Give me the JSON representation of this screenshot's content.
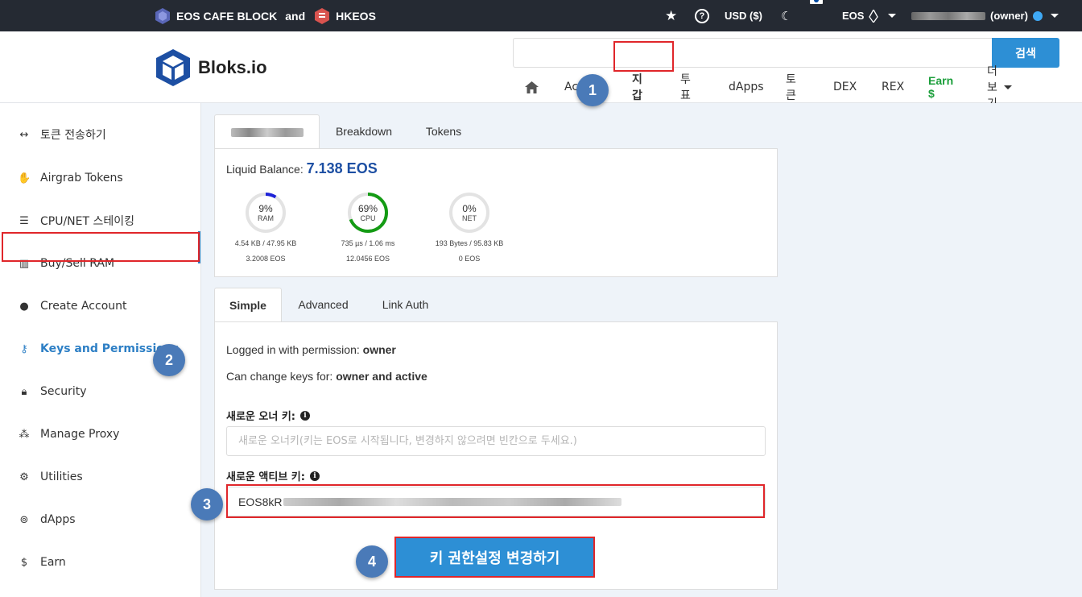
{
  "topbar": {
    "brand1": "EOS CAFE BLOCK",
    "and": "and",
    "brand2": "HKEOS",
    "currency": "USD ($)",
    "chain": "EOS",
    "account_suffix": "(owner)"
  },
  "header": {
    "logo": "Bloks.io",
    "search_placeholder": "",
    "search_button": "검색",
    "nav": [
      {
        "label": "Ac"
      },
      {
        "label": "지갑"
      },
      {
        "label": "투표"
      },
      {
        "label": "dApps"
      },
      {
        "label": "토큰"
      },
      {
        "label": "DEX"
      },
      {
        "label": "REX"
      },
      {
        "label": "Earn $"
      },
      {
        "label": "더보기"
      }
    ]
  },
  "sidebar": {
    "items": [
      {
        "label": "토큰 전송하기",
        "icon": "arrows-h-icon"
      },
      {
        "label": "Airgrab Tokens",
        "icon": "hand-icon"
      },
      {
        "label": "CPU/NET 스테이킹",
        "icon": "server-icon"
      },
      {
        "label": "Buy/Sell RAM",
        "icon": "memory-chip-icon"
      },
      {
        "label": "Create Account",
        "icon": "user-icon"
      },
      {
        "label": "Keys and Permissions",
        "icon": "key-icon"
      },
      {
        "label": "Security",
        "icon": "lock-icon"
      },
      {
        "label": "Manage Proxy",
        "icon": "users-icon"
      },
      {
        "label": "Utilities",
        "icon": "gear-icon"
      },
      {
        "label": "dApps",
        "icon": "gamepad-icon"
      },
      {
        "label": "Earn",
        "icon": "dollar-icon"
      }
    ]
  },
  "account_tabs": {
    "breakdown": "Breakdown",
    "tokens": "Tokens"
  },
  "balance": {
    "label": "Liquid Balance:",
    "value": "7.138 EOS",
    "ram": {
      "percent": "9%",
      "label": "RAM",
      "fraction": 0.09,
      "usage": "4.54 KB / 47.95 KB",
      "eos": "3.2008 EOS"
    },
    "cpu": {
      "percent": "69%",
      "label": "CPU",
      "fraction": 0.69,
      "usage": "735 µs / 1.06 ms",
      "eos": "12.0456 EOS"
    },
    "net": {
      "percent": "0%",
      "label": "NET",
      "fraction": 0.0,
      "usage": "193 Bytes / 95.83 KB",
      "eos": "0 EOS"
    }
  },
  "perm_tabs": {
    "simple": "Simple",
    "advanced": "Advanced",
    "linkauth": "Link Auth"
  },
  "permissions": {
    "logged_label": "Logged in with permission: ",
    "logged_value": "owner",
    "change_label": "Can change keys for: ",
    "change_value": "owner and active",
    "owner_key_label": "새로운 오너 키:",
    "owner_key_placeholder": "새로운 오너키(키는 EOS로 시작됩니다, 변경하지 않으려면 빈칸으로 두세요.)",
    "active_key_label": "새로운 액티브 키:",
    "active_key_prefix": "EOS8kR",
    "submit": "키 권한설정 변경하기"
  },
  "steps": [
    "1",
    "2",
    "3",
    "4"
  ],
  "colors": {
    "accent": "#2d8fd5",
    "highlight": "#e0262a",
    "step": "#4a7ab8",
    "earn": "#1a9e3a",
    "balance": "#1d4fa3"
  }
}
